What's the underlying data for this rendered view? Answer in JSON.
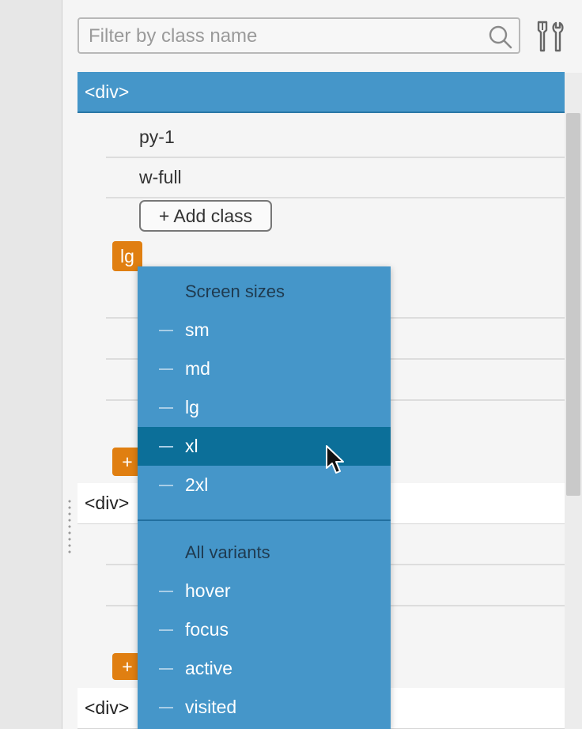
{
  "search": {
    "placeholder": "Filter by class name"
  },
  "tree": {
    "selected_element": "<div>",
    "classes": [
      "py-1",
      "w-full"
    ],
    "add_class_label": "+ Add class",
    "variant_badge": "lg",
    "add_badge": "+",
    "sibling_elements": [
      "<div>",
      "<div>"
    ]
  },
  "dropdown": {
    "screen_sizes_heading": "Screen sizes",
    "screen_sizes": [
      {
        "label": "sm"
      },
      {
        "label": "md"
      },
      {
        "label": "lg"
      },
      {
        "label": "xl"
      },
      {
        "label": "2xl"
      }
    ],
    "active_item": "xl",
    "variants_heading": "All variants",
    "variants": [
      {
        "label": "hover"
      },
      {
        "label": "focus"
      },
      {
        "label": "active"
      },
      {
        "label": "visited"
      }
    ]
  },
  "colors": {
    "accent": "#4596c9",
    "active_item": "#0c6f99",
    "badge": "#e07f11",
    "heading_text": "#1f3a4f"
  }
}
